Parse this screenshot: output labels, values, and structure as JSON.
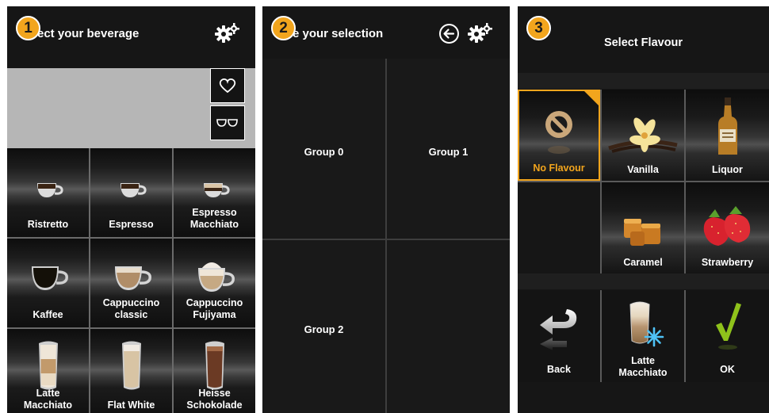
{
  "colors": {
    "accent": "#f2a51d",
    "panel_bg": "#161616",
    "check": "#8fc21b"
  },
  "panel1": {
    "step": "1",
    "title": "ect your beverage",
    "beverages": [
      {
        "name": "Ristretto",
        "icon": "small-espresso-cup-icon"
      },
      {
        "name": "Espresso",
        "icon": "small-espresso-cup-icon"
      },
      {
        "name": "Espresso\nMacchiato",
        "icon": "macchiato-cup-icon"
      },
      {
        "name": "Kaffee",
        "icon": "coffee-cup-icon"
      },
      {
        "name": "Cappuccino\nclassic",
        "icon": "cappuccino-cup-icon"
      },
      {
        "name": "Cappuccino\nFujiyama",
        "icon": "cappuccino-foam-cup-icon"
      },
      {
        "name": "Latte\nMacchiato",
        "icon": "latte-glass-icon"
      },
      {
        "name": "Flat White",
        "icon": "flat-white-glass-icon"
      },
      {
        "name": "Heisse\nSchokolade",
        "icon": "chocolate-glass-icon"
      }
    ]
  },
  "panel2": {
    "step": "2",
    "title": "e your selection",
    "groups": [
      "Group 0",
      "Group 1",
      "Group 2",
      ""
    ]
  },
  "panel3": {
    "step": "3",
    "title": "Select Flavour",
    "flavours": [
      {
        "name": "No Flavour",
        "icon": "no-flavour-icon",
        "selected": true
      },
      {
        "name": "Vanilla",
        "icon": "vanilla-icon"
      },
      {
        "name": "Liquor",
        "icon": "liquor-bottle-icon"
      },
      {
        "name": "",
        "icon": ""
      },
      {
        "name": "Caramel",
        "icon": "caramel-icon"
      },
      {
        "name": "Strawberry",
        "icon": "strawberry-icon"
      }
    ],
    "actions": {
      "back_label": "Back",
      "drink_label": "Latte\nMacchiato",
      "ok_label": "OK"
    }
  }
}
